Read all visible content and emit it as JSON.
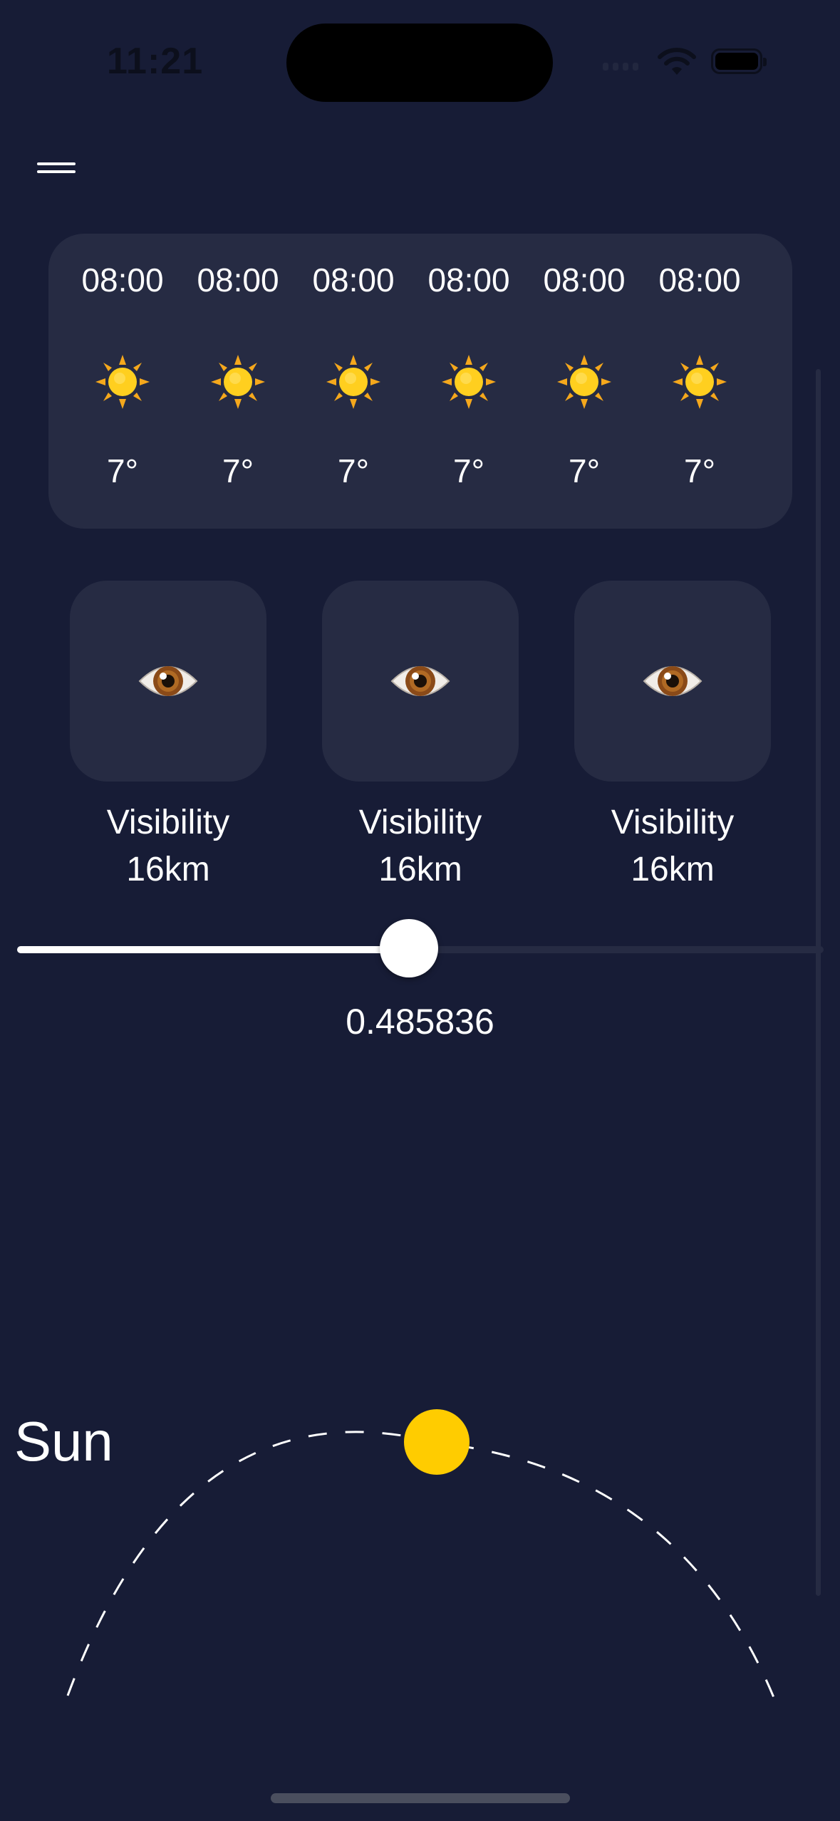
{
  "status_bar": {
    "time": "11:21"
  },
  "hourly": [
    {
      "time": "08:00",
      "icon": "sun-icon",
      "temp": "7°"
    },
    {
      "time": "08:00",
      "icon": "sun-icon",
      "temp": "7°"
    },
    {
      "time": "08:00",
      "icon": "sun-icon",
      "temp": "7°"
    },
    {
      "time": "08:00",
      "icon": "sun-icon",
      "temp": "7°"
    },
    {
      "time": "08:00",
      "icon": "sun-icon",
      "temp": "7°"
    },
    {
      "time": "08:00",
      "icon": "sun-icon",
      "temp": "7°"
    }
  ],
  "details": [
    {
      "icon": "eye-icon",
      "title": "Visibility",
      "value": "16km"
    },
    {
      "icon": "eye-icon",
      "title": "Visibility",
      "value": "16km"
    },
    {
      "icon": "eye-icon",
      "title": "Visibility",
      "value": "16km"
    }
  ],
  "slider": {
    "value": 0.485836,
    "label": "0.485836"
  },
  "sun": {
    "label": "Sun",
    "color": "#ffcc00"
  },
  "theme": {
    "background": "#171c36",
    "card": "#262b43"
  }
}
